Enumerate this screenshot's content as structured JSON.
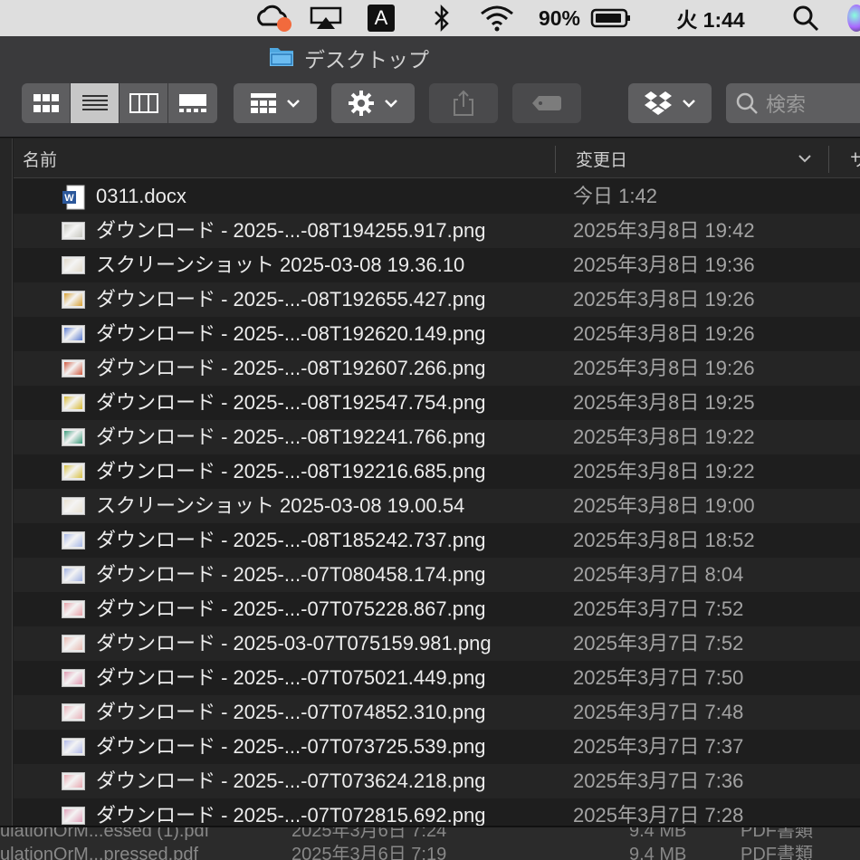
{
  "menubar": {
    "input_source": "A",
    "battery_percent": "90%",
    "clock": "火 1:44"
  },
  "window": {
    "title": "デスクトップ",
    "search_placeholder": "検索",
    "view_modes": [
      "icon-view",
      "list-view",
      "column-view",
      "gallery-view"
    ],
    "active_view": "list-view"
  },
  "columns": {
    "name": "名前",
    "modified": "変更日",
    "size_partial": "サ"
  },
  "files": [
    {
      "name": "0311.docx",
      "date": "今日 1:42",
      "icon": "word-doc-icon",
      "tint": ""
    },
    {
      "name": "ダウンロード - 2025-...-08T194255.917.png",
      "date": "2025年3月8日 19:42",
      "icon": "image-thumbnail-icon",
      "tint": "#c8c8c0"
    },
    {
      "name": "スクリーンショット 2025-03-08 19.36.10",
      "date": "2025年3月8日 19:36",
      "icon": "screenshot-thumbnail-icon",
      "tint": "#e0d8c8"
    },
    {
      "name": "ダウンロード - 2025-...-08T192655.427.png",
      "date": "2025年3月8日 19:26",
      "icon": "image-thumbnail-icon",
      "tint": "#d9a030"
    },
    {
      "name": "ダウンロード - 2025-...-08T192620.149.png",
      "date": "2025年3月8日 19:26",
      "icon": "image-thumbnail-icon",
      "tint": "#5a7ad0"
    },
    {
      "name": "ダウンロード - 2025-...-08T192607.266.png",
      "date": "2025年3月8日 19:26",
      "icon": "image-thumbnail-icon",
      "tint": "#d05a40"
    },
    {
      "name": "ダウンロード - 2025-...-08T192547.754.png",
      "date": "2025年3月8日 19:25",
      "icon": "image-thumbnail-icon",
      "tint": "#d8b830"
    },
    {
      "name": "ダウンロード - 2025-...-08T192241.766.png",
      "date": "2025年3月8日 19:22",
      "icon": "image-thumbnail-icon",
      "tint": "#3a9a7a"
    },
    {
      "name": "ダウンロード - 2025-...-08T192216.685.png",
      "date": "2025年3月8日 19:22",
      "icon": "image-thumbnail-icon",
      "tint": "#d8c040"
    },
    {
      "name": "スクリーンショット 2025-03-08 19.00.54",
      "date": "2025年3月8日 19:00",
      "icon": "screenshot-thumbnail-icon",
      "tint": "#e8e0d0"
    },
    {
      "name": "ダウンロード - 2025-...-08T185242.737.png",
      "date": "2025年3月8日 18:52",
      "icon": "image-thumbnail-icon",
      "tint": "#a8b8e8"
    },
    {
      "name": "ダウンロード - 2025-...-07T080458.174.png",
      "date": "2025年3月7日 8:04",
      "icon": "image-thumbnail-icon",
      "tint": "#a0b0e0"
    },
    {
      "name": "ダウンロード - 2025-...-07T075228.867.png",
      "date": "2025年3月7日 7:52",
      "icon": "image-thumbnail-icon",
      "tint": "#e8a0a8"
    },
    {
      "name": "ダウンロード - 2025-03-07T075159.981.png",
      "date": "2025年3月7日 7:52",
      "icon": "image-thumbnail-icon",
      "tint": "#e8b8b0"
    },
    {
      "name": "ダウンロード - 2025-...-07T075021.449.png",
      "date": "2025年3月7日 7:50",
      "icon": "image-thumbnail-icon",
      "tint": "#e098b0"
    },
    {
      "name": "ダウンロード - 2025-...-07T074852.310.png",
      "date": "2025年3月7日 7:48",
      "icon": "image-thumbnail-icon",
      "tint": "#e8b0b8"
    },
    {
      "name": "ダウンロード - 2025-...-07T073725.539.png",
      "date": "2025年3月7日 7:37",
      "icon": "image-thumbnail-icon",
      "tint": "#b0b8e8"
    },
    {
      "name": "ダウンロード - 2025-...-07T073624.218.png",
      "date": "2025年3月7日 7:36",
      "icon": "image-thumbnail-icon",
      "tint": "#e8a8b0"
    },
    {
      "name": "ダウンロード - 2025-...-07T072815.692.png",
      "date": "2025年3月7日 7:28",
      "icon": "image-thumbnail-icon",
      "tint": "#e0a0b8"
    }
  ],
  "background_window": {
    "rows": [
      {
        "name": "ulationOrM...essed (1).pdf",
        "date": "2025年3月6日 7:24",
        "size": "9.4 MB",
        "kind": "PDF書類"
      },
      {
        "name": "ulationOrM...pressed.pdf",
        "date": "2025年3月6日 7:19",
        "size": "9.4 MB",
        "kind": "PDF書類"
      }
    ]
  }
}
